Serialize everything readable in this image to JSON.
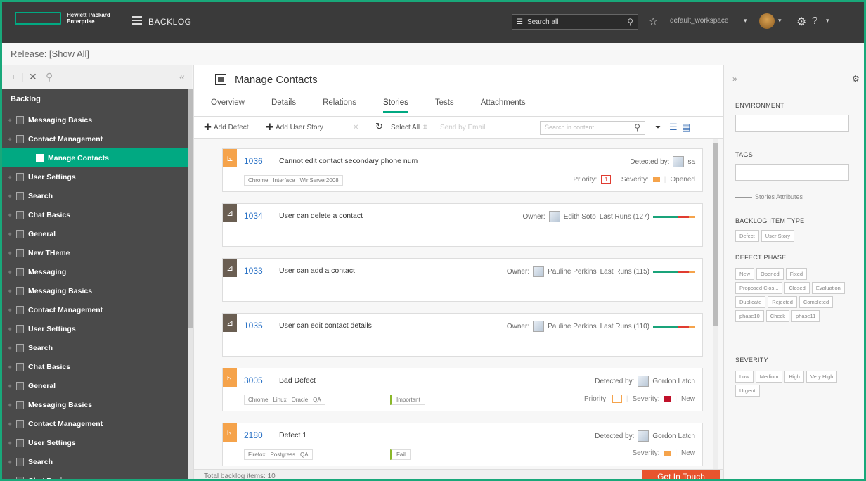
{
  "brand": {
    "line1": "Hewlett Packard",
    "line2": "Enterprise"
  },
  "module": "BACKLOG",
  "topbar": {
    "search_placeholder": "Search all",
    "workspace": "default_workspace"
  },
  "release": "Release: [Show All]",
  "tree": {
    "root": "Backlog",
    "items": [
      {
        "label": "Messaging Basics",
        "selected": false,
        "child": false
      },
      {
        "label": "Contact Management",
        "selected": false,
        "child": false
      },
      {
        "label": "Manage Contacts",
        "selected": true,
        "child": true
      },
      {
        "label": "User Settings",
        "selected": false,
        "child": false
      },
      {
        "label": "Search",
        "selected": false,
        "child": false
      },
      {
        "label": "Chat Basics",
        "selected": false,
        "child": false
      },
      {
        "label": "General",
        "selected": false,
        "child": false
      },
      {
        "label": "New THeme",
        "selected": false,
        "child": false
      },
      {
        "label": "Messaging",
        "selected": false,
        "child": false
      },
      {
        "label": "Messaging Basics",
        "selected": false,
        "child": false
      },
      {
        "label": "Contact Management",
        "selected": false,
        "child": false
      },
      {
        "label": "User Settings",
        "selected": false,
        "child": false
      },
      {
        "label": "Search",
        "selected": false,
        "child": false
      },
      {
        "label": "Chat Basics",
        "selected": false,
        "child": false
      },
      {
        "label": "General",
        "selected": false,
        "child": false
      },
      {
        "label": "Messaging Basics",
        "selected": false,
        "child": false
      },
      {
        "label": "Contact Management",
        "selected": false,
        "child": false
      },
      {
        "label": "User Settings",
        "selected": false,
        "child": false
      },
      {
        "label": "Search",
        "selected": false,
        "child": false
      },
      {
        "label": "Chat Basics",
        "selected": false,
        "child": false
      }
    ]
  },
  "entity": {
    "title": "Manage Contacts"
  },
  "tabs": [
    "Overview",
    "Details",
    "Relations",
    "Stories",
    "Tests",
    "Attachments"
  ],
  "active_tab": "Stories",
  "toolbar": {
    "add_defect": "Add Defect",
    "add_story": "Add User Story",
    "select_all": "Select All",
    "send_email": "Send by Email",
    "search_placeholder": "Search in content"
  },
  "cards": [
    {
      "kind": "defect",
      "id": "1036",
      "name": "Cannot edit contact secondary phone num",
      "person_label": "Detected by:",
      "person": "sa",
      "tags": [
        "Chrome",
        "Interface",
        "WinServer2008"
      ],
      "priority_label": "Priority:",
      "priority": "1",
      "severity_label": "Severity:",
      "status": "Opened"
    },
    {
      "kind": "story",
      "id": "1034",
      "name": "User can delete a contact",
      "person_label": "Owner:",
      "person": "Edith Soto",
      "runs": "Last Runs (127)"
    },
    {
      "kind": "story",
      "id": "1033",
      "name": "User can add a contact",
      "person_label": "Owner:",
      "person": "Pauline Perkins",
      "runs": "Last Runs (115)"
    },
    {
      "kind": "story",
      "id": "1035",
      "name": "User can edit contact details",
      "person_label": "Owner:",
      "person": "Pauline Perkins",
      "runs": "Last Runs (110)"
    },
    {
      "kind": "defect",
      "id": "3005",
      "name": "Bad Defect",
      "person_label": "Detected by:",
      "person": "Gordon Latch",
      "tags": [
        "Chrome",
        "Linux",
        "Oracle",
        "QA"
      ],
      "tag2": "Important",
      "priority_label": "Priority:",
      "priority": "",
      "severity_label": "Severity:",
      "status": "New"
    },
    {
      "kind": "defect",
      "id": "2180",
      "name": "Defect 1",
      "person_label": "Detected by:",
      "person": "Gordon Latch",
      "tags": [
        "Firefox",
        "Postgress",
        "QA"
      ],
      "tag2": "Fail",
      "severity_label": "Severity:",
      "status": "New"
    }
  ],
  "footer": {
    "total": "Total backlog items: 10",
    "cta": "Get In Touch"
  },
  "right_panel": {
    "environment": "ENVIRONMENT",
    "tags": "TAGS",
    "stories_attributes": "Stories Attributes",
    "item_type_label": "BACKLOG ITEM TYPE",
    "item_types": [
      "Defect",
      "User Story"
    ],
    "phase_label": "DEFECT PHASE",
    "phases": [
      "New",
      "Opened",
      "Fixed",
      "Proposed Clos...",
      "Closed",
      "Evaluation",
      "Duplicate",
      "Rejected",
      "Completed",
      "phase10",
      "Check",
      "phase11"
    ],
    "severity_label": "SEVERITY",
    "severities": [
      "Low",
      "Medium",
      "High",
      "Very High",
      "Urgent"
    ]
  }
}
